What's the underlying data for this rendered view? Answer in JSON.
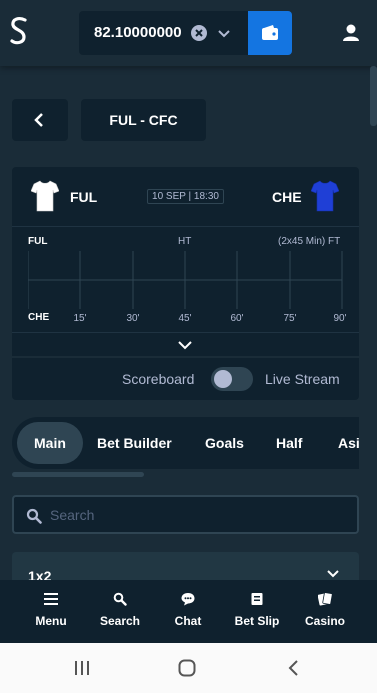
{
  "header": {
    "balance": "82.10000000",
    "logo_icon": "stake-logo-icon",
    "wallet_icon": "wallet-icon",
    "user_icon": "user-icon"
  },
  "match": {
    "title": "FUL - CFC",
    "home_team": "FUL",
    "away_team": "CHE",
    "date_time": "10 SEP | 18:30",
    "home_shirt_color": "#ffffff",
    "away_shirt_color": "#1f3fd6"
  },
  "timeline": {
    "home_label": "FUL",
    "away_label": "CHE",
    "ht_label": "HT",
    "ft_label": "(2x45 Min) FT",
    "ticks": [
      "15'",
      "30'",
      "45'",
      "60'",
      "75'",
      "90'"
    ]
  },
  "stream": {
    "scoreboard_label": "Scoreboard",
    "live_stream_label": "Live Stream",
    "toggle_on": false
  },
  "tabs": {
    "items": [
      {
        "label": "Main",
        "active": true
      },
      {
        "label": "Bet Builder",
        "active": false
      },
      {
        "label": "Goals",
        "active": false
      },
      {
        "label": "Half",
        "active": false
      },
      {
        "label": "Asi",
        "active": false
      }
    ]
  },
  "search": {
    "placeholder": "Search",
    "value": ""
  },
  "market": {
    "title": "1x2"
  },
  "bottom_nav": {
    "items": [
      {
        "label": "Menu",
        "icon": "menu-icon"
      },
      {
        "label": "Search",
        "icon": "search-icon"
      },
      {
        "label": "Chat",
        "icon": "chat-icon"
      },
      {
        "label": "Bet Slip",
        "icon": "bet-slip-icon"
      },
      {
        "label": "Casino",
        "icon": "casino-icon"
      }
    ]
  },
  "colors": {
    "background": "#1a2c38",
    "panel": "#0f212e",
    "accent_blue": "#1475e1",
    "muted_text": "#b1bad3"
  }
}
